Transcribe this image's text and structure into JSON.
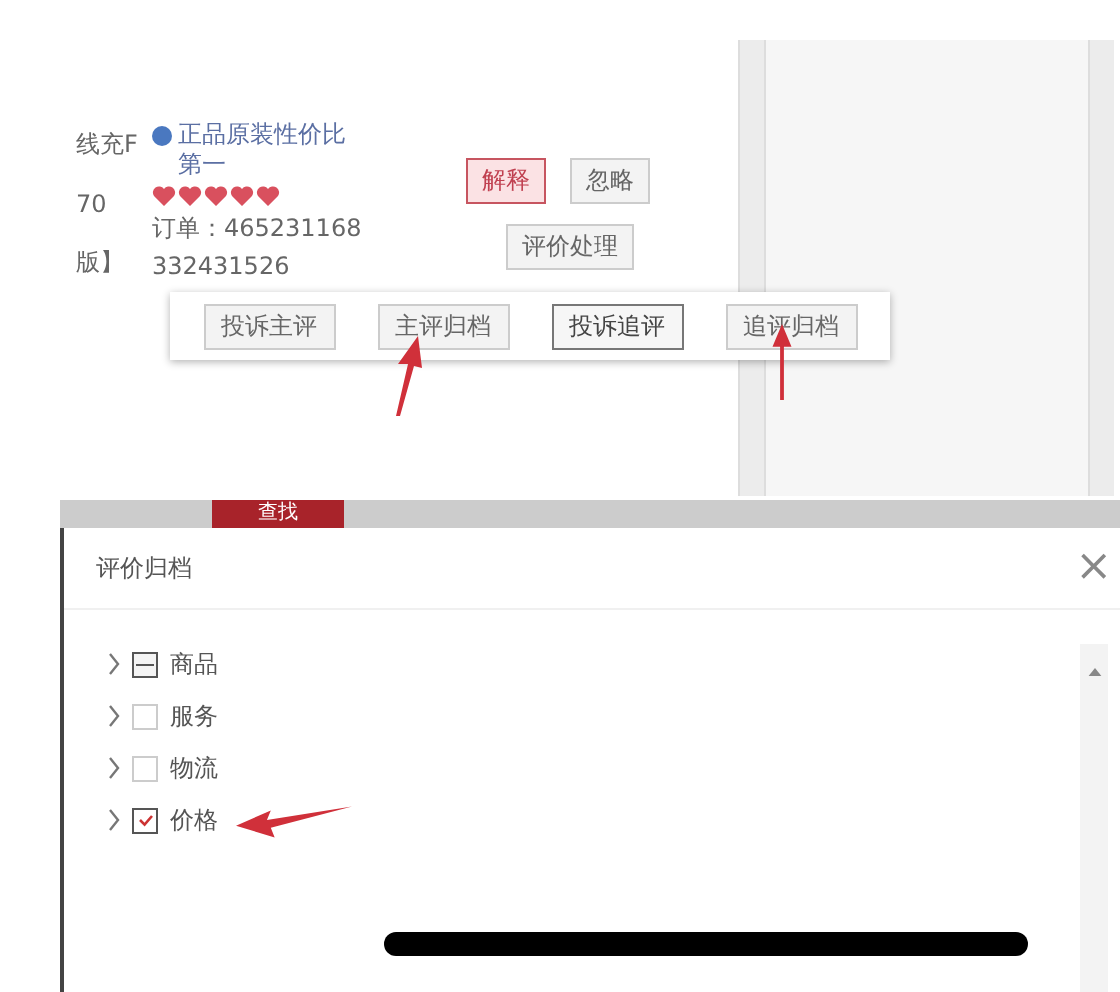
{
  "left_column": [
    "线充F",
    "70",
    "版】"
  ],
  "review": {
    "product": "正品原装性价比第一",
    "stars": 5,
    "order": "订单：465231168",
    "order_2": "332431526"
  },
  "actions": [
    {
      "label": "解释",
      "kind": "primary"
    },
    {
      "label": "忽略",
      "kind": "plain"
    }
  ],
  "menu_button": "评价处理",
  "popup_buttons": [
    {
      "label": "投诉主评",
      "emphasized": false
    },
    {
      "label": "主评归档",
      "emphasized": false
    },
    {
      "label": "投诉追评",
      "emphasized": true
    },
    {
      "label": "追评归档",
      "emphasized": false
    }
  ],
  "search_tab": "查找",
  "dialog": {
    "title": "评价归档",
    "close": "×",
    "tree": [
      {
        "label": "商品",
        "checked": false,
        "indeterminate": true
      },
      {
        "label": "服务",
        "checked": false,
        "indeterminate": false
      },
      {
        "label": "物流",
        "checked": false,
        "indeterminate": false
      },
      {
        "label": "价格",
        "checked": true,
        "indeterminate": false
      }
    ]
  }
}
